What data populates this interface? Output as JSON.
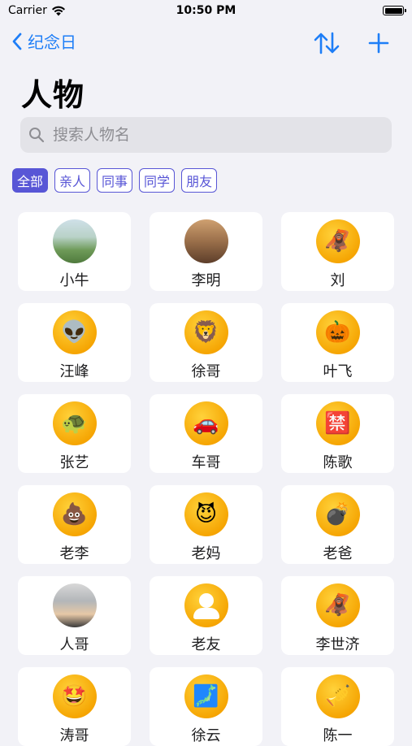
{
  "status_bar": {
    "carrier": "Carrier",
    "time": "10:50 PM"
  },
  "nav": {
    "back_label": "纪念日"
  },
  "page_title": "人物",
  "search": {
    "placeholder": "搜索人物名",
    "value": ""
  },
  "filters": [
    {
      "label": "全部",
      "active": true
    },
    {
      "label": "亲人",
      "active": false
    },
    {
      "label": "同事",
      "active": false
    },
    {
      "label": "同学",
      "active": false
    },
    {
      "label": "朋友",
      "active": false
    }
  ],
  "people": [
    {
      "name": "小牛",
      "avatar": "photo-1",
      "icon": "photo-avatar"
    },
    {
      "name": "李明",
      "avatar": "photo-2",
      "icon": "photo-avatar"
    },
    {
      "name": "刘",
      "avatar": "🦧",
      "icon": "orangutan-icon"
    },
    {
      "name": "汪峰",
      "avatar": "👽",
      "icon": "alien-icon"
    },
    {
      "name": "徐哥",
      "avatar": "🦁",
      "icon": "lion-icon"
    },
    {
      "name": "叶飞",
      "avatar": "🎃",
      "icon": "pumpkin-icon"
    },
    {
      "name": "张艺",
      "avatar": "🐢",
      "icon": "turtle-icon"
    },
    {
      "name": "车哥",
      "avatar": "🚗",
      "icon": "car-icon"
    },
    {
      "name": "陈歌",
      "avatar": "🈲",
      "icon": "prohibited-sign-icon"
    },
    {
      "name": "老李",
      "avatar": "💩",
      "icon": "poop-icon"
    },
    {
      "name": "老妈",
      "avatar": "😈",
      "icon": "devil-icon"
    },
    {
      "name": "老爸",
      "avatar": "💣",
      "icon": "bomb-icon"
    },
    {
      "name": "人哥",
      "avatar": "photo-3",
      "icon": "photo-avatar"
    },
    {
      "name": "老友",
      "avatar": "person",
      "icon": "person-icon"
    },
    {
      "name": "李世济",
      "avatar": "🦧",
      "icon": "orangutan-icon"
    },
    {
      "name": "涛哥",
      "avatar": "🤩",
      "icon": "star-struck-icon"
    },
    {
      "name": "徐云",
      "avatar": "🗾",
      "icon": "map-icon"
    },
    {
      "name": "陈一",
      "avatar": "🎺",
      "icon": "trumpet-icon"
    }
  ]
}
